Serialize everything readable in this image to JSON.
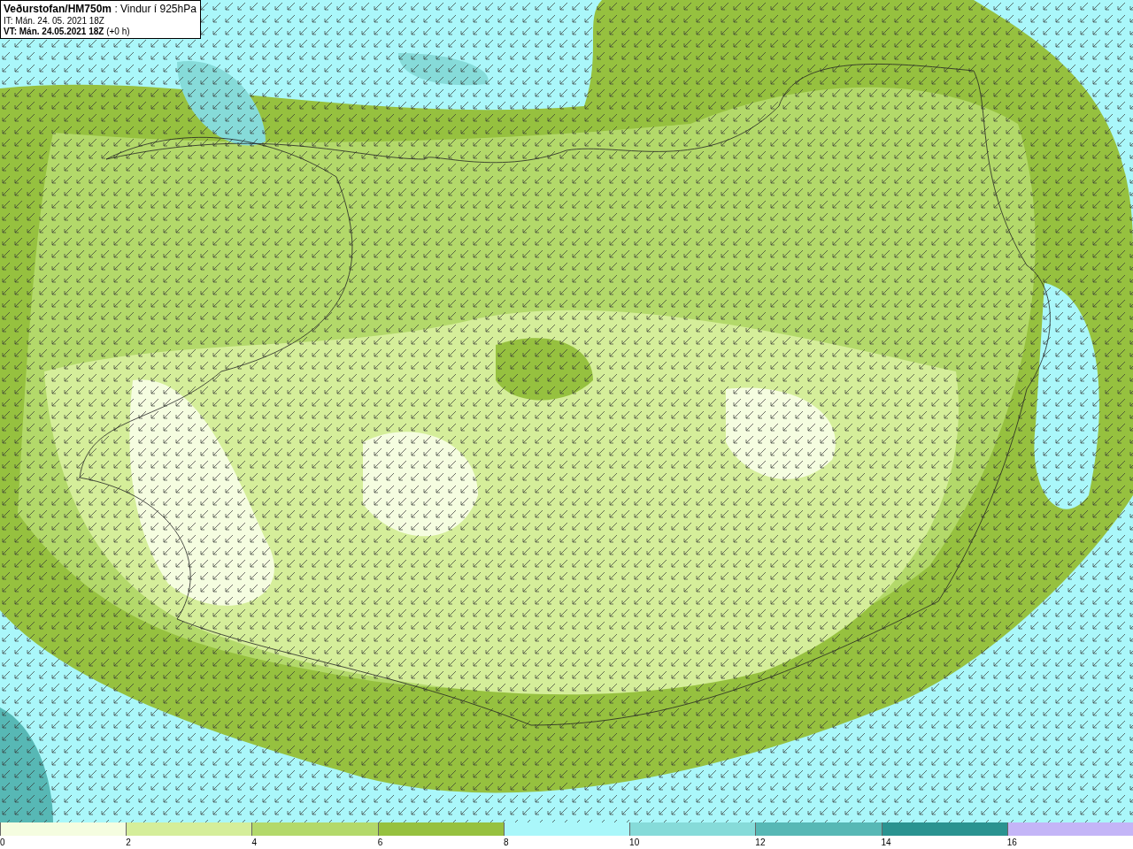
{
  "header": {
    "title": "**Veðurstofan/HM750m** : Vindur í 925hPa",
    "issue_time": "IT: Mán. 24. 05. 2021 18Z",
    "valid_time": "**VT: Mán. 24.05.2021 18Z** (+0 h)"
  },
  "legend": [
    {
      "color": "#f5fde0",
      "tick": "0"
    },
    {
      "color": "#d5ee9a",
      "tick": "2"
    },
    {
      "color": "#b3d96a",
      "tick": "4"
    },
    {
      "color": "#96c13f",
      "tick": "6"
    },
    {
      "color": "#aaf7fa",
      "tick": "8"
    },
    {
      "color": "#86dbd9",
      "tick": "10"
    },
    {
      "color": "#57b8b5",
      "tick": "12"
    },
    {
      "color": "#2a9390",
      "tick": "14"
    },
    {
      "color": "#c4b5f7",
      "tick": "16"
    }
  ]
}
